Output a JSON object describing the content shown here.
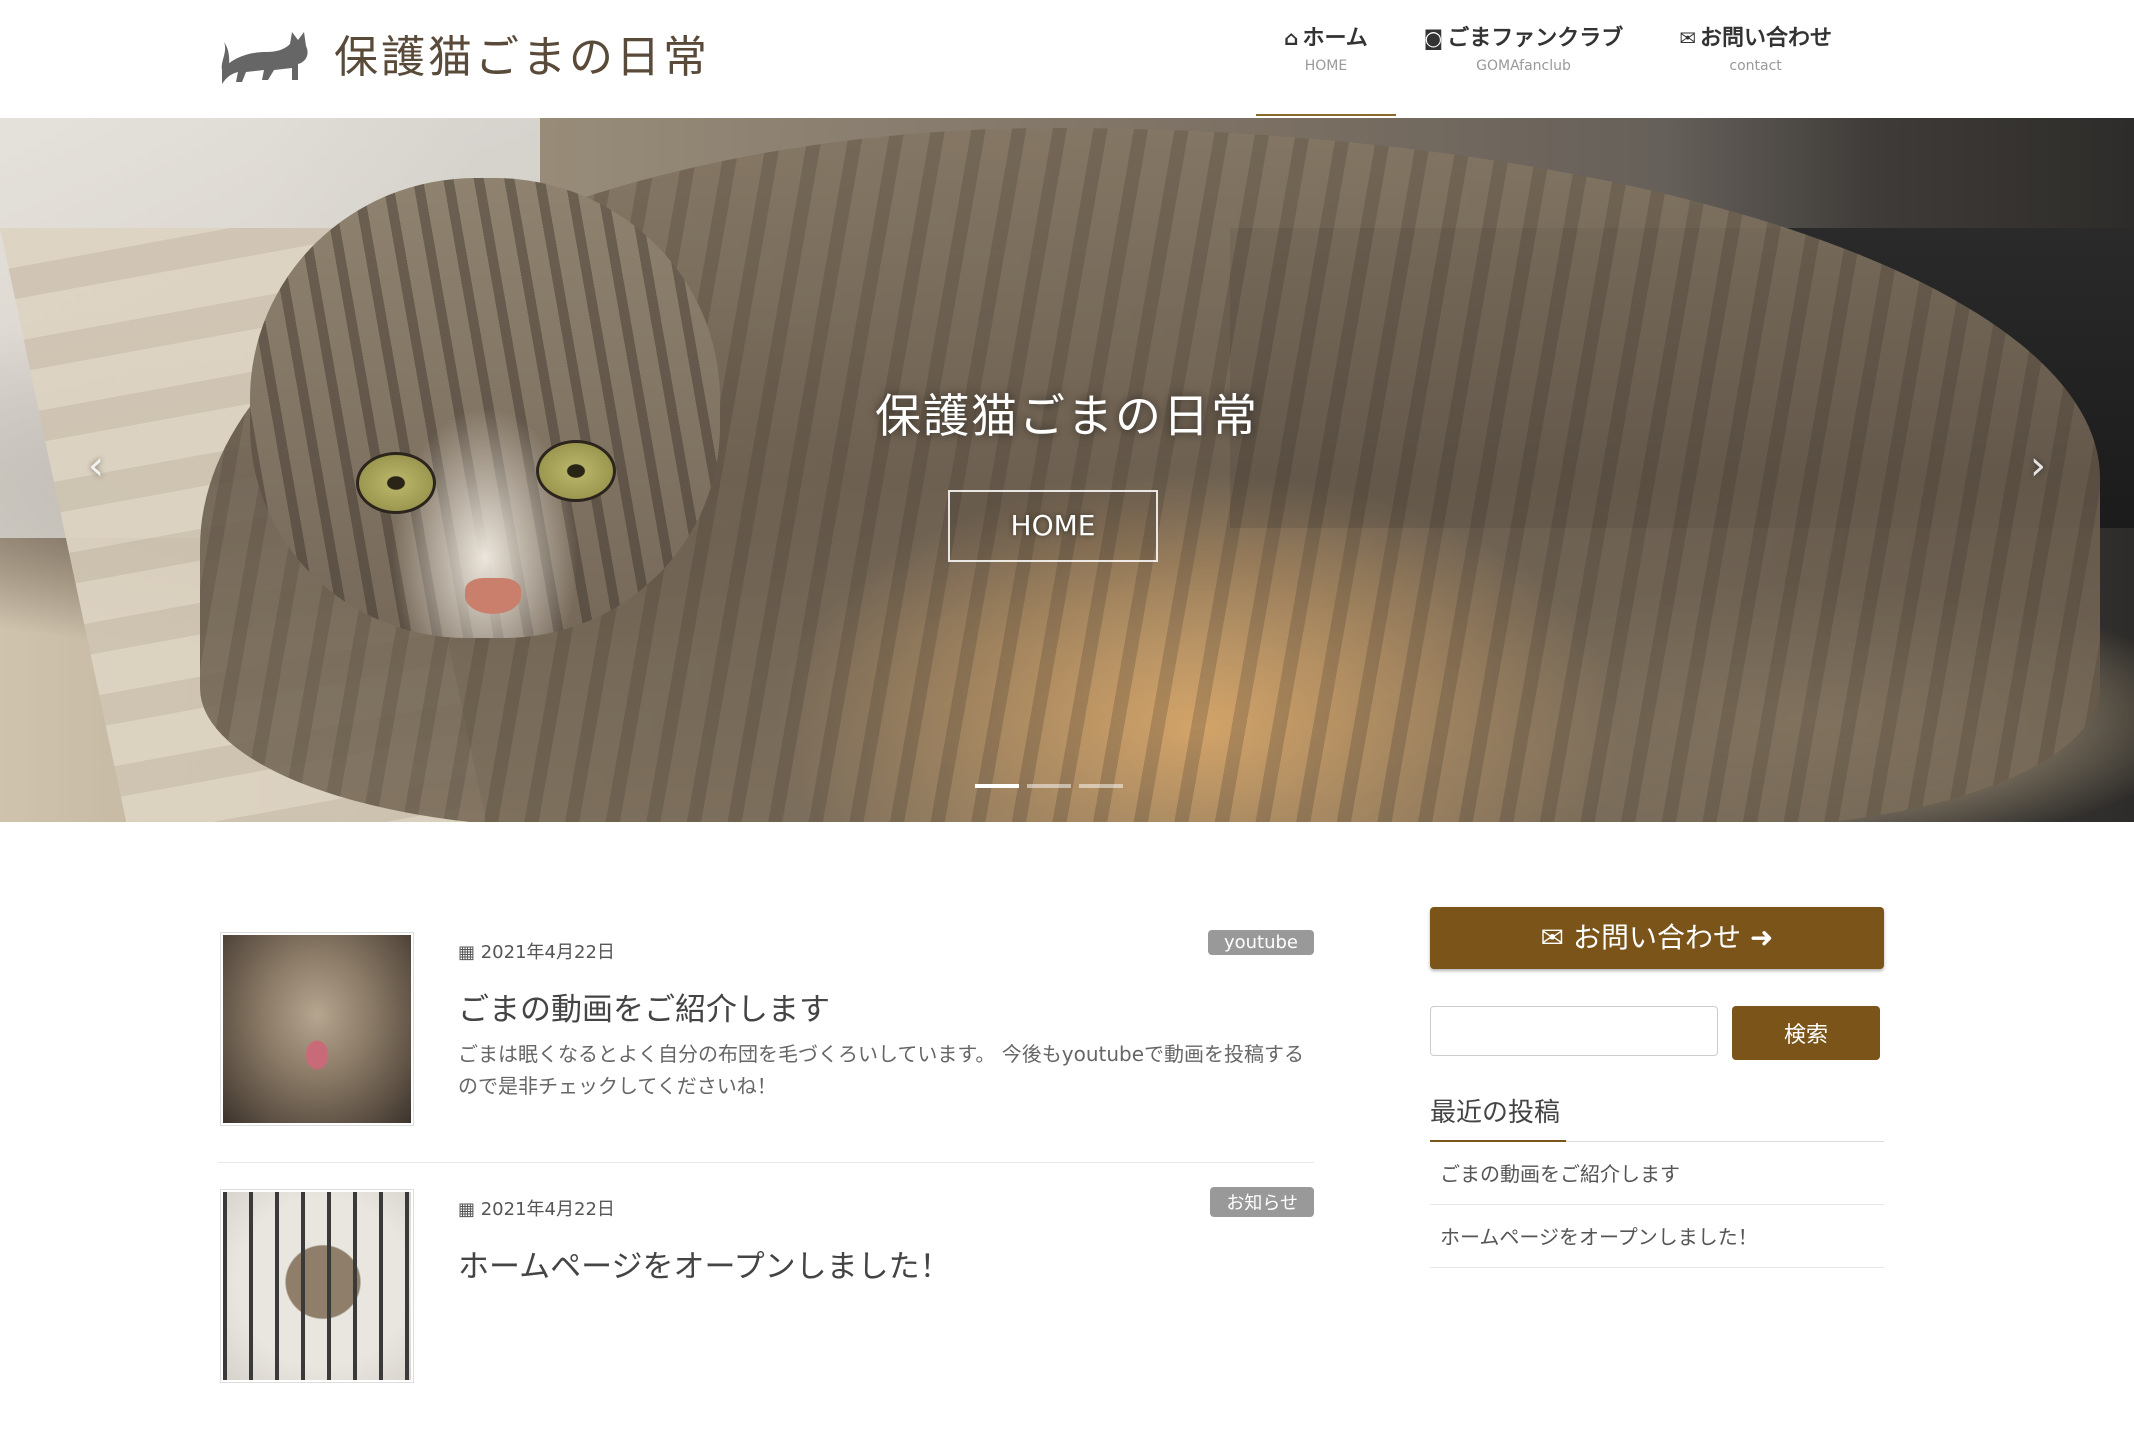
{
  "header": {
    "site_title": "保護猫ごまの日常",
    "nav": [
      {
        "label": "ホーム",
        "sub": "HOME",
        "icon": "home-icon"
      },
      {
        "label": "ごまファンクラブ",
        "sub": "GOMAfanclub",
        "icon": "camera-icon"
      },
      {
        "label": "お問い合わせ",
        "sub": "contact",
        "icon": "envelope-icon"
      }
    ]
  },
  "hero": {
    "title": "保護猫ごまの日常",
    "button_label": "HOME",
    "prev_icon": "chevron-left-icon",
    "next_icon": "chevron-right-icon",
    "slide_count": 3,
    "active_slide": 1
  },
  "posts": [
    {
      "date": "2021年4月22日",
      "category": "youtube",
      "title": "ごまの動画をご紹介します",
      "excerpt": "ごまは眠くなるとよく自分の布団を毛づくろいしています。 今後もyoutubeで動画を投稿するので是非チェックしてくださいね！"
    },
    {
      "date": "2021年4月22日",
      "category": "お知らせ",
      "title": "ホームページをオープンしました！",
      "excerpt": ""
    }
  ],
  "sidebar": {
    "contact_button": "お問い合わせ",
    "search": {
      "value": "",
      "placeholder": "",
      "button": "検索"
    },
    "recent_heading": "最近の投稿",
    "recent_posts": [
      "ごまの動画をご紹介します",
      "ホームページをオープンしました！"
    ]
  },
  "colors": {
    "accent": "#7a5419",
    "badge": "#999999",
    "logo_text": "#5a4a3a"
  }
}
